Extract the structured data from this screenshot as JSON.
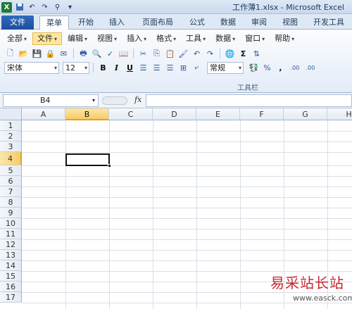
{
  "titlebar": {
    "title": "工作薄1.xlsx - Microsoft Excel",
    "logo_letter": "X"
  },
  "tabs": [
    {
      "label": "文件",
      "kind": "file"
    },
    {
      "label": "菜单",
      "kind": "active"
    },
    {
      "label": "开始",
      "kind": "normal"
    },
    {
      "label": "插入",
      "kind": "normal"
    },
    {
      "label": "页面布局",
      "kind": "normal"
    },
    {
      "label": "公式",
      "kind": "normal"
    },
    {
      "label": "数据",
      "kind": "normal"
    },
    {
      "label": "审阅",
      "kind": "normal"
    },
    {
      "label": "视图",
      "kind": "normal"
    },
    {
      "label": "开发工具",
      "kind": "normal"
    }
  ],
  "menubar": [
    {
      "label": "全部",
      "highlight": false
    },
    {
      "label": "文件",
      "highlight": true
    },
    {
      "label": "编辑",
      "highlight": false
    },
    {
      "label": "视图",
      "highlight": false
    },
    {
      "label": "插入",
      "highlight": false
    },
    {
      "label": "格式",
      "highlight": false
    },
    {
      "label": "工具",
      "highlight": false
    },
    {
      "label": "数据",
      "highlight": false
    },
    {
      "label": "窗口",
      "highlight": false
    },
    {
      "label": "帮助",
      "highlight": false
    }
  ],
  "format_bar": {
    "font_name": "宋体",
    "font_size": "12",
    "bold": "B",
    "italic": "I",
    "underline": "U",
    "number_format": "常规",
    "percent": "%",
    "comma": ",",
    "inc_decimal": ".00",
    "dec_decimal": ".00"
  },
  "ribbon_group_label": "工具栏",
  "formula_bar": {
    "name_box": "B4",
    "fx": "fx",
    "formula": ""
  },
  "sheet": {
    "columns": [
      "A",
      "B",
      "C",
      "D",
      "E",
      "F",
      "G",
      "H"
    ],
    "rows": [
      "1",
      "2",
      "3",
      "4",
      "5",
      "6",
      "7",
      "8",
      "9",
      "10",
      "11",
      "12",
      "13",
      "14",
      "15",
      "16",
      "17"
    ],
    "selected_column": "B",
    "selected_row": "4"
  },
  "watermark": {
    "text_cn": "易采站长站",
    "url": "www.easck.com"
  },
  "colors": {
    "file_tab": "#1d4f9a",
    "selection_header": "#f6cd67",
    "watermark_red": "#c6262e"
  }
}
